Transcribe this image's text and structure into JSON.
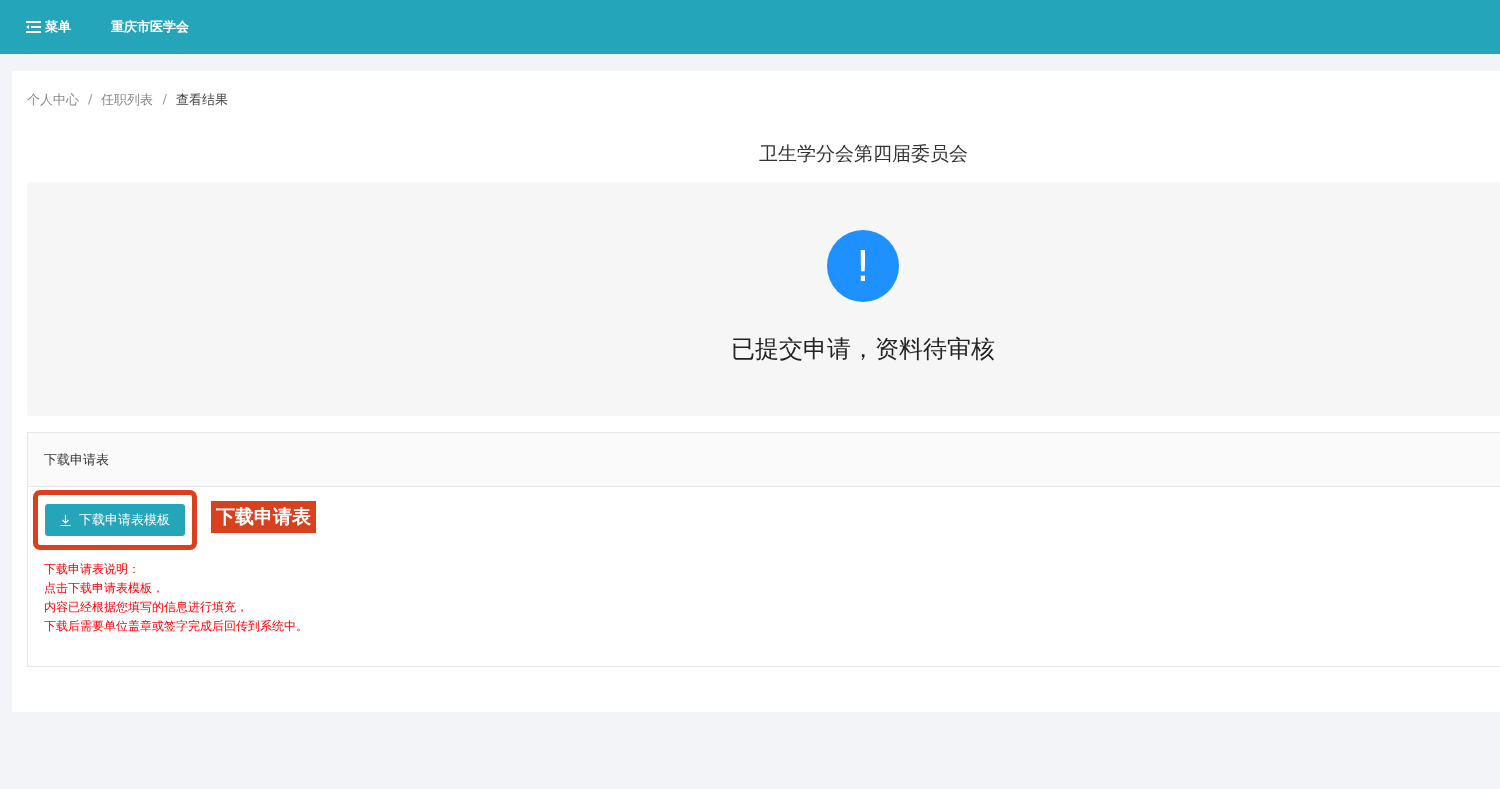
{
  "header": {
    "menu_label": "菜单",
    "site_title": "重庆市医学会"
  },
  "breadcrumb": [
    {
      "label": "个人中心",
      "current": false
    },
    {
      "label": "任职列表",
      "current": false
    },
    {
      "label": "查看结果",
      "current": true
    }
  ],
  "breadcrumb_separator": "/",
  "page_title": "卫生学分会第四届委员会",
  "result": {
    "color": "#1e90ff",
    "message": "已提交申请，资料待审核",
    "icon_text": "!"
  },
  "download_card": {
    "title": "下载申请表",
    "button_label": "下载申请表模板",
    "annotation_label": "下载申请表",
    "notes": [
      "下载申请表说明：",
      "点击下载申请表模板，",
      "内容已经根据您填写的信息进行填充，",
      "下载后需要单位盖章或签字完成后回传到系统中。"
    ]
  }
}
